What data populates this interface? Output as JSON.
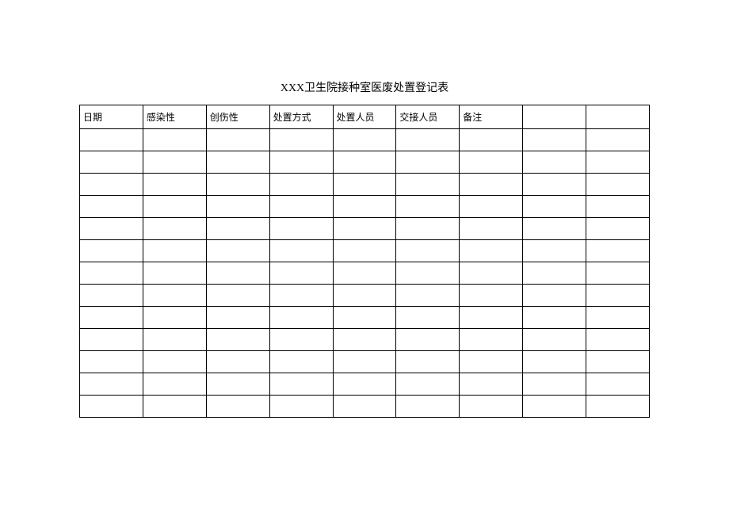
{
  "title": "XXX卫生院接种室医废处置登记表",
  "headers": [
    "日期",
    "感染性",
    "创伤性",
    "处置方式",
    "处置人员",
    "交接人员",
    "备注",
    "",
    ""
  ],
  "rowCount": 13
}
